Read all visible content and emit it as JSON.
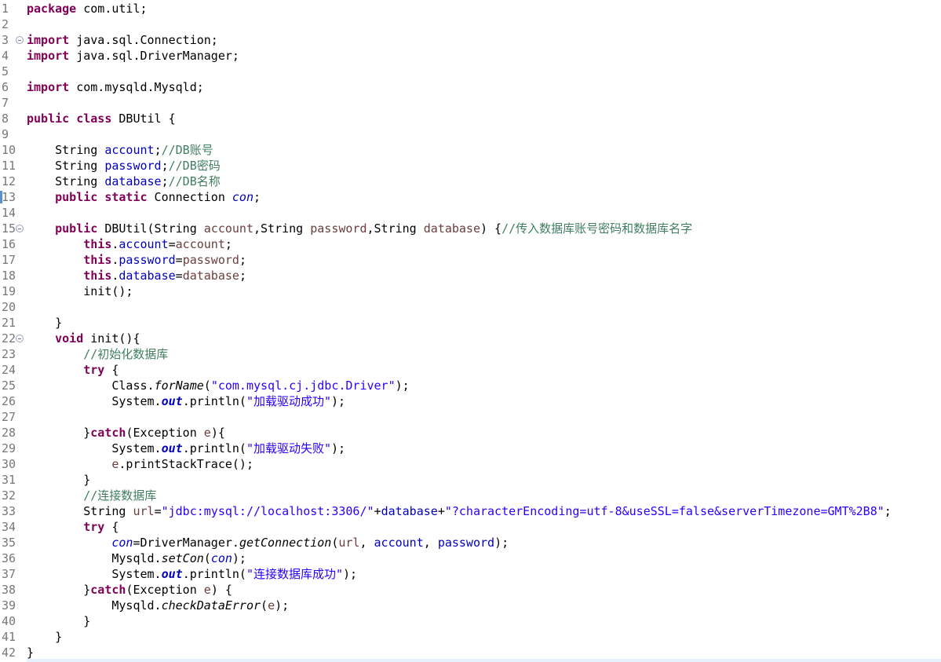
{
  "lines": [
    [
      [
        "k",
        "package"
      ],
      [
        "p",
        " com.util;"
      ]
    ],
    [],
    [
      [
        "k",
        "import"
      ],
      [
        "p",
        " java.sql.Connection;"
      ]
    ],
    [
      [
        "k",
        "import"
      ],
      [
        "p",
        " java.sql.DriverManager;"
      ]
    ],
    [],
    [
      [
        "k",
        "import"
      ],
      [
        "p",
        " com.mysqld.Mysqld;"
      ]
    ],
    [],
    [
      [
        "k",
        "public"
      ],
      [
        "p",
        " "
      ],
      [
        "k",
        "class"
      ],
      [
        "p",
        " DBUtil {"
      ]
    ],
    [],
    [
      [
        "p",
        "    String "
      ],
      [
        "f",
        "account"
      ],
      [
        "p",
        ";"
      ],
      [
        "c",
        "//DB账号"
      ]
    ],
    [
      [
        "p",
        "    String "
      ],
      [
        "f",
        "password"
      ],
      [
        "p",
        ";"
      ],
      [
        "c",
        "//DB密码"
      ]
    ],
    [
      [
        "p",
        "    String "
      ],
      [
        "f",
        "database"
      ],
      [
        "p",
        ";"
      ],
      [
        "c",
        "//DB名称"
      ]
    ],
    [
      [
        "p",
        "    "
      ],
      [
        "k",
        "public"
      ],
      [
        "p",
        " "
      ],
      [
        "k",
        "static"
      ],
      [
        "p",
        " Connection "
      ],
      [
        "si",
        "con"
      ],
      [
        "p",
        ";"
      ]
    ],
    [],
    [
      [
        "p",
        "    "
      ],
      [
        "k",
        "public"
      ],
      [
        "p",
        " DBUtil(String "
      ],
      [
        "l",
        "account"
      ],
      [
        "p",
        ",String "
      ],
      [
        "l",
        "password"
      ],
      [
        "p",
        ",String "
      ],
      [
        "l",
        "database"
      ],
      [
        "p",
        ") {"
      ],
      [
        "c",
        "//传入数据库账号密码和数据库名字"
      ]
    ],
    [
      [
        "p",
        "        "
      ],
      [
        "k",
        "this"
      ],
      [
        "p",
        "."
      ],
      [
        "f",
        "account"
      ],
      [
        "p",
        "="
      ],
      [
        "l",
        "account"
      ],
      [
        "p",
        ";"
      ]
    ],
    [
      [
        "p",
        "        "
      ],
      [
        "k",
        "this"
      ],
      [
        "p",
        "."
      ],
      [
        "f",
        "password"
      ],
      [
        "p",
        "="
      ],
      [
        "l",
        "password"
      ],
      [
        "p",
        ";"
      ]
    ],
    [
      [
        "p",
        "        "
      ],
      [
        "k",
        "this"
      ],
      [
        "p",
        "."
      ],
      [
        "f",
        "database"
      ],
      [
        "p",
        "="
      ],
      [
        "l",
        "database"
      ],
      [
        "p",
        ";"
      ]
    ],
    [
      [
        "p",
        "        init();"
      ]
    ],
    [],
    [
      [
        "p",
        "    }"
      ]
    ],
    [
      [
        "p",
        "    "
      ],
      [
        "k",
        "void"
      ],
      [
        "p",
        " init(){"
      ]
    ],
    [
      [
        "p",
        "        "
      ],
      [
        "c",
        "//初始化数据库"
      ]
    ],
    [
      [
        "p",
        "        "
      ],
      [
        "k",
        "try"
      ],
      [
        "p",
        " {"
      ]
    ],
    [
      [
        "p",
        "            Class."
      ],
      [
        "sm",
        "forName"
      ],
      [
        "p",
        "("
      ],
      [
        "s",
        "\"com.mysql.cj.jdbc.Driver\""
      ],
      [
        "p",
        ");"
      ]
    ],
    [
      [
        "p",
        "            System."
      ],
      [
        "sf",
        "out"
      ],
      [
        "p",
        ".println("
      ],
      [
        "s",
        "\"加载驱动成功\""
      ],
      [
        "p",
        ");"
      ]
    ],
    [],
    [
      [
        "p",
        "        }"
      ],
      [
        "k",
        "catch"
      ],
      [
        "p",
        "(Exception "
      ],
      [
        "l",
        "e"
      ],
      [
        "p",
        "){"
      ]
    ],
    [
      [
        "p",
        "            System."
      ],
      [
        "sf",
        "out"
      ],
      [
        "p",
        ".println("
      ],
      [
        "s",
        "\"加载驱动失败\""
      ],
      [
        "p",
        ");"
      ]
    ],
    [
      [
        "p",
        "            "
      ],
      [
        "l",
        "e"
      ],
      [
        "p",
        ".printStackTrace();"
      ]
    ],
    [
      [
        "p",
        "        }"
      ]
    ],
    [
      [
        "p",
        "        "
      ],
      [
        "c",
        "//连接数据库"
      ]
    ],
    [
      [
        "p",
        "        String "
      ],
      [
        "l",
        "url"
      ],
      [
        "p",
        "="
      ],
      [
        "s",
        "\"jdbc:mysql://localhost:3306/\""
      ],
      [
        "p",
        "+"
      ],
      [
        "f",
        "database"
      ],
      [
        "p",
        "+"
      ],
      [
        "s",
        "\"?characterEncoding=utf-8&useSSL=false&serverTimezone=GMT%2B8\""
      ],
      [
        "p",
        ";"
      ]
    ],
    [
      [
        "p",
        "        "
      ],
      [
        "k",
        "try"
      ],
      [
        "p",
        " {"
      ]
    ],
    [
      [
        "p",
        "            "
      ],
      [
        "si",
        "con"
      ],
      [
        "p",
        "=DriverManager."
      ],
      [
        "sm",
        "getConnection"
      ],
      [
        "p",
        "("
      ],
      [
        "l",
        "url"
      ],
      [
        "p",
        ", "
      ],
      [
        "f",
        "account"
      ],
      [
        "p",
        ", "
      ],
      [
        "f",
        "password"
      ],
      [
        "p",
        ");"
      ]
    ],
    [
      [
        "p",
        "            Mysqld."
      ],
      [
        "sm",
        "setCon"
      ],
      [
        "p",
        "("
      ],
      [
        "si",
        "con"
      ],
      [
        "p",
        ");"
      ]
    ],
    [
      [
        "p",
        "            System."
      ],
      [
        "sf",
        "out"
      ],
      [
        "p",
        ".println("
      ],
      [
        "s",
        "\"连接数据库成功\""
      ],
      [
        "p",
        ");"
      ]
    ],
    [
      [
        "p",
        "        }"
      ],
      [
        "k",
        "catch"
      ],
      [
        "p",
        "(Exception "
      ],
      [
        "l",
        "e"
      ],
      [
        "p",
        ") {"
      ]
    ],
    [
      [
        "p",
        "            Mysqld."
      ],
      [
        "sm",
        "checkDataError"
      ],
      [
        "p",
        "("
      ],
      [
        "l",
        "e"
      ],
      [
        "p",
        ");"
      ]
    ],
    [
      [
        "p",
        "        }"
      ]
    ],
    [
      [
        "p",
        "    }"
      ]
    ],
    [
      [
        "p",
        "}"
      ]
    ]
  ],
  "line_numbers": [
    "1",
    "2",
    "3",
    "4",
    "5",
    "6",
    "7",
    "8",
    "9",
    "10",
    "11",
    "12",
    "13",
    "14",
    "15",
    "16",
    "17",
    "18",
    "19",
    "20",
    "21",
    "22",
    "23",
    "24",
    "25",
    "26",
    "27",
    "28",
    "29",
    "30",
    "31",
    "32",
    "33",
    "34",
    "35",
    "36",
    "37",
    "38",
    "39",
    "40",
    "41",
    "42"
  ],
  "fold_lines": [
    3,
    15,
    22
  ],
  "marker_lines": [
    13
  ],
  "colors": {
    "keyword": "#7f0055",
    "field": "#0000c0",
    "local": "#6a3e3e",
    "string": "#2a00ff",
    "comment": "#3f7f5f"
  }
}
